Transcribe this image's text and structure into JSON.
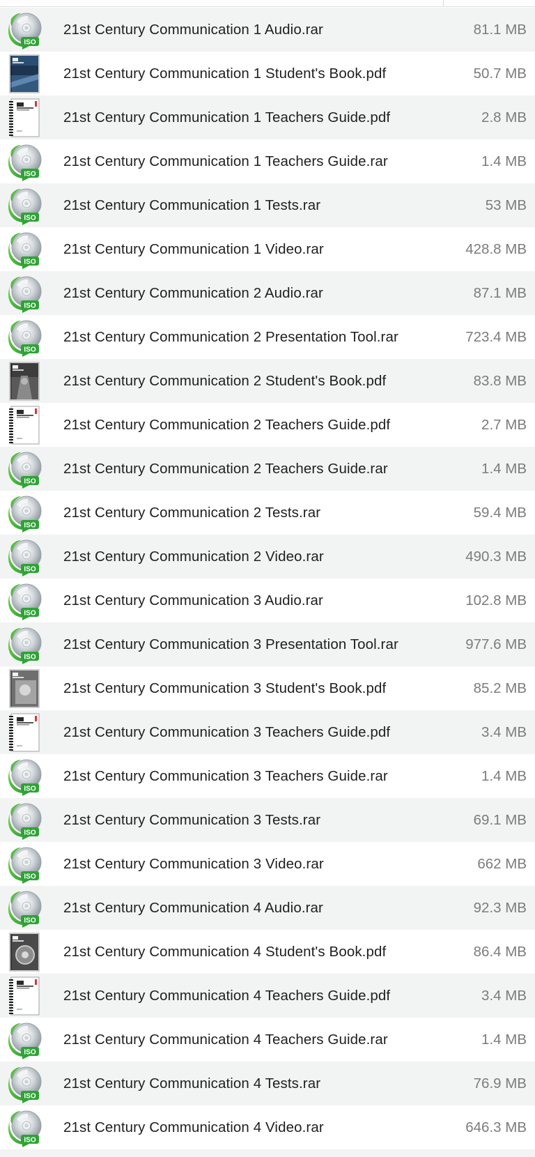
{
  "colors": {
    "stripe": "#f2f3f3",
    "name_text": "#1f1f1f",
    "size_text": "#7c7c7c",
    "iso_green": "#2fa336",
    "iso_arrow": "#49c23a"
  },
  "icon_types": {
    "iso": "iso-archive-icon",
    "book_cover": "book-cover-icon",
    "guide_cover": "teachers-guide-cover-icon"
  },
  "files": [
    {
      "name": "21st Century Communication 1 Audio.rar",
      "size": "81.1 MB",
      "icon": "iso"
    },
    {
      "name": "21st Century Communication 1 Student's Book.pdf",
      "size": "50.7 MB",
      "icon": "book_blue"
    },
    {
      "name": "21st Century Communication 1 Teachers Guide.pdf",
      "size": "2.8 MB",
      "icon": "guide"
    },
    {
      "name": "21st Century Communication 1 Teachers Guide.rar",
      "size": "1.4 MB",
      "icon": "iso"
    },
    {
      "name": "21st Century Communication 1 Tests.rar",
      "size": "53 MB",
      "icon": "iso"
    },
    {
      "name": "21st Century Communication 1 Video.rar",
      "size": "428.8 MB",
      "icon": "iso"
    },
    {
      "name": "21st Century Communication 2 Audio.rar",
      "size": "87.1 MB",
      "icon": "iso"
    },
    {
      "name": "21st Century Communication 2 Presentation Tool.rar",
      "size": "723.4 MB",
      "icon": "iso"
    },
    {
      "name": "21st Century Communication 2 Student's Book.pdf",
      "size": "83.8 MB",
      "icon": "book_dark"
    },
    {
      "name": "21st Century Communication 2 Teachers Guide.pdf",
      "size": "2.7 MB",
      "icon": "guide"
    },
    {
      "name": "21st Century Communication 2 Teachers Guide.rar",
      "size": "1.4 MB",
      "icon": "iso"
    },
    {
      "name": "21st Century Communication 2 Tests.rar",
      "size": "59.4 MB",
      "icon": "iso"
    },
    {
      "name": "21st Century Communication 2 Video.rar",
      "size": "490.3 MB",
      "icon": "iso"
    },
    {
      "name": "21st Century Communication 3 Audio.rar",
      "size": "102.8 MB",
      "icon": "iso"
    },
    {
      "name": "21st Century Communication 3 Presentation Tool.rar",
      "size": "977.6 MB",
      "icon": "iso"
    },
    {
      "name": "21st Century Communication 3 Student's Book.pdf",
      "size": "85.2 MB",
      "icon": "book_grey"
    },
    {
      "name": "21st Century Communication 3 Teachers Guide.pdf",
      "size": "3.4 MB",
      "icon": "guide"
    },
    {
      "name": "21st Century Communication 3 Teachers Guide.rar",
      "size": "1.4 MB",
      "icon": "iso"
    },
    {
      "name": "21st Century Communication 3 Tests.rar",
      "size": "69.1 MB",
      "icon": "iso"
    },
    {
      "name": "21st Century Communication 3 Video.rar",
      "size": "662 MB",
      "icon": "iso"
    },
    {
      "name": "21st Century Communication 4 Audio.rar",
      "size": "92.3 MB",
      "icon": "iso"
    },
    {
      "name": "21st Century Communication 4 Student's Book.pdf",
      "size": "86.4 MB",
      "icon": "book_gear"
    },
    {
      "name": "21st Century Communication 4 Teachers Guide.pdf",
      "size": "3.4 MB",
      "icon": "guide"
    },
    {
      "name": "21st Century Communication 4 Teachers Guide.rar",
      "size": "1.4 MB",
      "icon": "iso"
    },
    {
      "name": "21st Century Communication 4 Tests.rar",
      "size": "76.9 MB",
      "icon": "iso"
    },
    {
      "name": "21st Century Communication 4 Video.rar",
      "size": "646.3 MB",
      "icon": "iso"
    }
  ]
}
